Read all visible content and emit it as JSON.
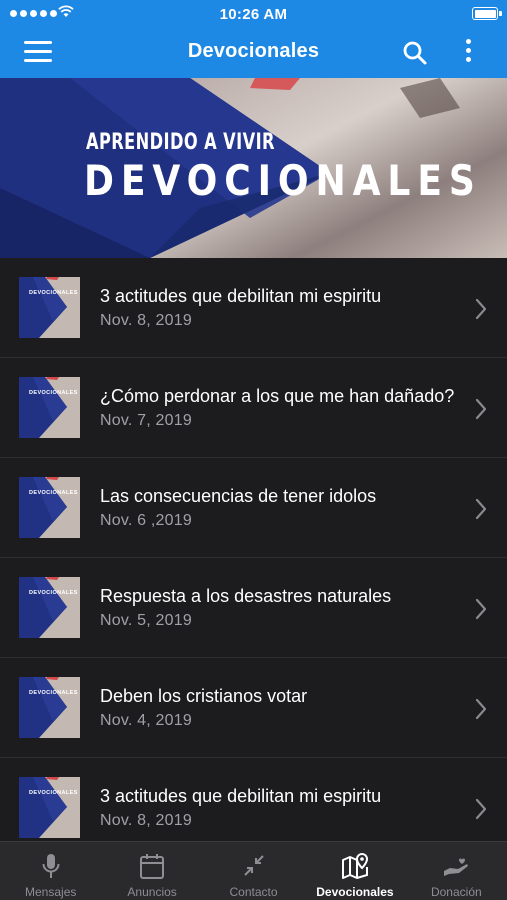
{
  "status_bar": {
    "time": "10:26 AM"
  },
  "header": {
    "title": "Devocionales"
  },
  "banner": {
    "subtitle": "APRENDIDO A VIVIR",
    "title": "DEVOCIONALES"
  },
  "list": {
    "thumb_text": "DEVOCIONALES",
    "items": [
      {
        "title": "3 actitudes que debilitan mi espiritu",
        "date": "Nov. 8, 2019"
      },
      {
        "title": "¿Cómo perdonar a los que me han dañado?",
        "date": "Nov. 7, 2019"
      },
      {
        "title": "Las consecuencias de tener idolos",
        "date": "Nov. 6 ,2019"
      },
      {
        "title": "Respuesta a los desastres naturales",
        "date": "Nov. 5, 2019"
      },
      {
        "title": "Deben los cristianos votar",
        "date": "Nov. 4, 2019"
      },
      {
        "title": "3 actitudes que debilitan mi espiritu",
        "date": "Nov. 8, 2019"
      }
    ]
  },
  "tabs": [
    {
      "label": "Mensajes",
      "icon": "microphone-icon"
    },
    {
      "label": "Anuncios",
      "icon": "calendar-icon"
    },
    {
      "label": "Contacto",
      "icon": "arrows-in-icon"
    },
    {
      "label": "Devocionales",
      "icon": "map-pin-icon",
      "active": true
    },
    {
      "label": "Donación",
      "icon": "hand-heart-icon"
    }
  ],
  "colors": {
    "accent": "#1e88e5",
    "background": "#1c1c1e",
    "tab_bar": "#2a2a2c"
  }
}
